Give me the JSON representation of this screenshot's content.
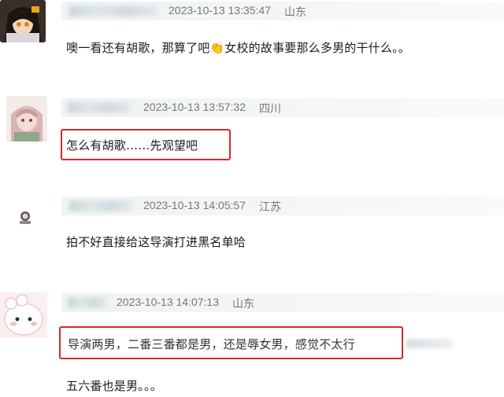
{
  "comments": [
    {
      "time": "2023-10-13 13:35:47",
      "location": "山东",
      "text": "噢一看还有胡歌，那算了吧👏女校的故事要那么多男的干什么。。"
    },
    {
      "time": "2023-10-13 13:57:32",
      "location": "四川",
      "text": "怎么有胡歌……先观望吧"
    },
    {
      "time": "2023-10-13 14:05:57",
      "location": "江苏",
      "text": "拍不好直接给这导演打进黑名单哈"
    },
    {
      "time": "2023-10-13 14:07:13",
      "location": "山东",
      "text": "导演两男，二番三番都是男，还是辱女男，感觉不太行",
      "followup": "五六番也是男。。。"
    }
  ],
  "colors": {
    "highlight": "#d12a2a",
    "meta_bar": "#eef4f1",
    "meta_text": "#777777"
  }
}
